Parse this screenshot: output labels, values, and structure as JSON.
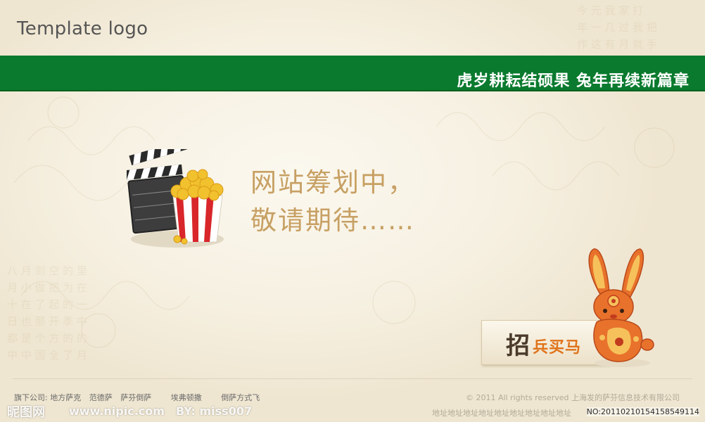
{
  "header": {
    "logo_text": "Template logo",
    "slogan": "虎岁耕耘结硕果  兔年再续新篇章",
    "banner_color": "#0a7a2e"
  },
  "main": {
    "message_line1": "网站筹划中，",
    "message_line2": "敬请期待……",
    "message_color": "#c7a063",
    "illustration_icon": "clapperboard-popcorn-icon"
  },
  "recruit": {
    "big_char": "招",
    "rest_text": "兵买马",
    "accent_color": "#e0731a",
    "mascot_icon": "rabbit-icon"
  },
  "footer": {
    "subsidiaries": [
      "旗下公司: 地方萨克",
      "范德萨",
      "萨芬倒萨",
      "埃弗顿撒",
      "倒萨方式飞"
    ],
    "copyright": "© 2011 All rights reserved 上海发的萨芬信息技术有限公司",
    "address": "地址地址地址地址地址地址地址地址地址",
    "watermark_site": "昵图网",
    "watermark_url": "www.nipic.com",
    "watermark_by": "BY: miss007",
    "watermark_id": "NO:20110210154158549114"
  }
}
